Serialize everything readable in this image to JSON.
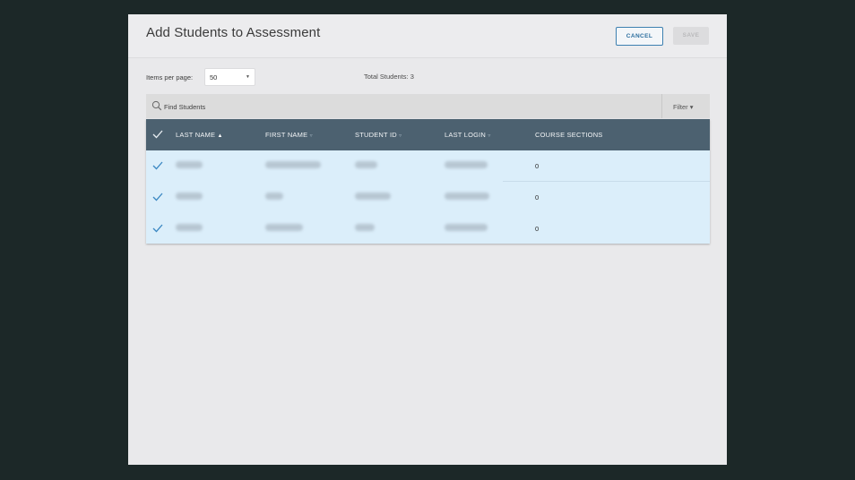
{
  "dialog": {
    "title": "Add Students to Assessment",
    "cancel_label": "CANCEL",
    "save_label": "SAVE"
  },
  "pagination": {
    "items_per_page_label": "Items per page:",
    "items_per_page_value": "50"
  },
  "summary": {
    "total_students": "Total Students: 3"
  },
  "search": {
    "placeholder": "Find Students",
    "filter_label": "Filter ▾"
  },
  "table": {
    "columns": [
      {
        "label": "LAST NAME",
        "sort": "▲"
      },
      {
        "label": "FIRST NAME",
        "sort": "▿"
      },
      {
        "label": "STUDENT ID",
        "sort": "▿"
      },
      {
        "label": "LAST LOGIN",
        "sort": "▿"
      },
      {
        "label": "COURSE SECTIONS",
        "sort": ""
      }
    ],
    "rows": [
      {
        "course_sections": "0"
      },
      {
        "course_sections": "0"
      },
      {
        "course_sections": "0"
      }
    ]
  },
  "colors": {
    "header_bg": "#4c6170",
    "row_selected_bg": "#dbeefa",
    "accent": "#2d6f9f",
    "check": "#3a87c2"
  },
  "icons": [
    "search-icon",
    "checkmark-icon",
    "caret-down-icon",
    "sort-up-icon",
    "sort-down-icon"
  ]
}
